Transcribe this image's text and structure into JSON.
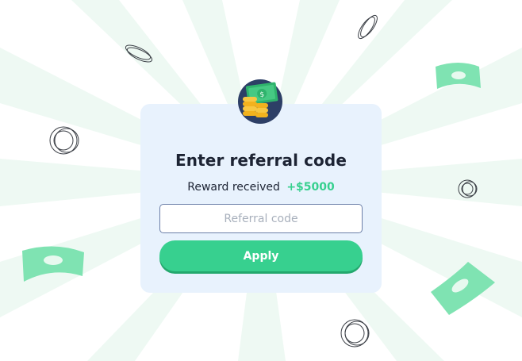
{
  "modal": {
    "title": "Enter referral code",
    "reward_label": "Reward received",
    "reward_amount": "+$5000",
    "referral_input": {
      "placeholder": "Referral code",
      "value": ""
    },
    "apply_label": "Apply",
    "avatar_icon": "money-coins-icon"
  },
  "theme": {
    "accent": "#37d08f",
    "modal_bg": "#e8f2fd",
    "text": "#1d2434",
    "ray_color": "#eaf8f1"
  }
}
